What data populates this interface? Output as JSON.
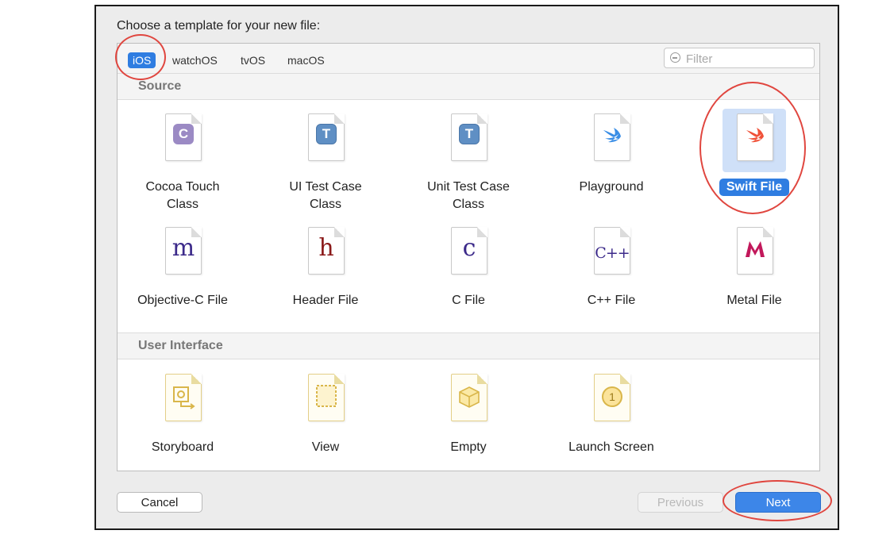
{
  "dialog": {
    "prompt": "Choose a template for your new file:"
  },
  "platform_tabs": [
    {
      "label": "iOS",
      "selected": true
    },
    {
      "label": "watchOS",
      "selected": false
    },
    {
      "label": "tvOS",
      "selected": false
    },
    {
      "label": "macOS",
      "selected": false
    }
  ],
  "filter": {
    "placeholder": "Filter",
    "value": ""
  },
  "sections": [
    {
      "title": "Source",
      "items": [
        {
          "label": "Cocoa Touch\nClass",
          "icon": "cocoa-touch-class-icon",
          "glyph": "C"
        },
        {
          "label": "UI Test Case\nClass",
          "icon": "ui-test-case-class-icon",
          "glyph": "T"
        },
        {
          "label": "Unit Test Case\nClass",
          "icon": "unit-test-case-class-icon",
          "glyph": "T"
        },
        {
          "label": "Playground",
          "icon": "playground-icon",
          "glyph": ""
        },
        {
          "label": "Swift File",
          "icon": "swift-file-icon",
          "glyph": "",
          "selected": true
        },
        {
          "label": "Objective-C File",
          "icon": "objective-c-file-icon",
          "glyph": "m"
        },
        {
          "label": "Header File",
          "icon": "header-file-icon",
          "glyph": "h"
        },
        {
          "label": "C File",
          "icon": "c-file-icon",
          "glyph": "c"
        },
        {
          "label": "C++ File",
          "icon": "cpp-file-icon",
          "glyph": "C++"
        },
        {
          "label": "Metal File",
          "icon": "metal-file-icon",
          "glyph": ""
        }
      ]
    },
    {
      "title": "User Interface",
      "items": [
        {
          "label": "Storyboard",
          "icon": "storyboard-icon"
        },
        {
          "label": "View",
          "icon": "view-icon"
        },
        {
          "label": "Empty",
          "icon": "empty-icon"
        },
        {
          "label": "Launch Screen",
          "icon": "launch-screen-icon",
          "glyph": "1"
        }
      ]
    }
  ],
  "buttons": {
    "cancel": "Cancel",
    "previous": "Previous",
    "next": "Next"
  },
  "colors": {
    "selection_blue": "#2f7de1",
    "next_button": "#3d86e8",
    "annotation_red": "#e0463f",
    "swift_orange": "#f05138",
    "metal_magenta": "#c2185b",
    "objc_purple": "#3c2a8a",
    "header_red": "#8b1a1a"
  }
}
